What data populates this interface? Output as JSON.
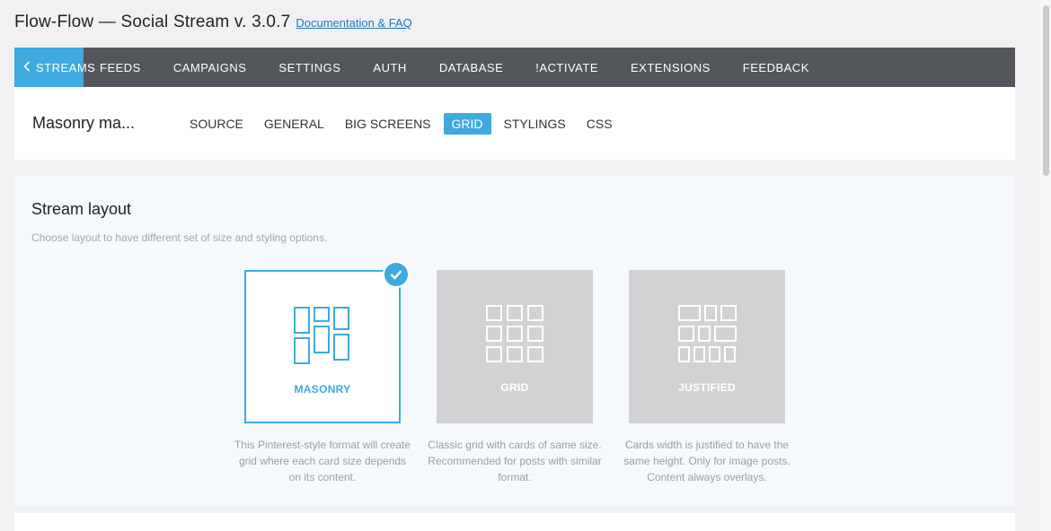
{
  "header": {
    "title": "Flow-Flow — Social Stream v. 3.0.7",
    "doc_link": "Documentation & FAQ"
  },
  "nav": {
    "items": [
      "STREAMS",
      "FEEDS",
      "CAMPAIGNS",
      "SETTINGS",
      "AUTH",
      "DATABASE",
      "!ACTIVATE",
      "EXTENSIONS",
      "FEEDBACK"
    ],
    "active": "STREAMS",
    "back_icon": "chevron-left-icon"
  },
  "stream": {
    "name": "Masonry ma...",
    "tabs": [
      "SOURCE",
      "GENERAL",
      "BIG SCREENS",
      "GRID",
      "STYLINGS",
      "CSS"
    ],
    "active_tab": "GRID"
  },
  "layout_section": {
    "title": "Stream layout",
    "description": "Choose layout to have different set of size and styling options.",
    "options": [
      {
        "label": "MASONRY",
        "icon": "masonry-layout-icon",
        "selected": true,
        "description": "This Pinterest-style format will create grid where each card size depends on its content."
      },
      {
        "label": "GRID",
        "icon": "grid-layout-icon",
        "selected": false,
        "description": "Classic grid with cards of same size. Recommended for posts with similar format."
      },
      {
        "label": "JUSTIFIED",
        "icon": "justified-layout-icon",
        "selected": false,
        "description": "Cards width is justified to have the same height. Only for image posts. Content always overlays."
      }
    ]
  },
  "colors": {
    "accent": "#3eaadf",
    "nav_bg": "#53565b",
    "page_bg": "#f1f1f4",
    "panel_bg": "#f5f9fd",
    "unselected_card": "#d2d2d4"
  }
}
